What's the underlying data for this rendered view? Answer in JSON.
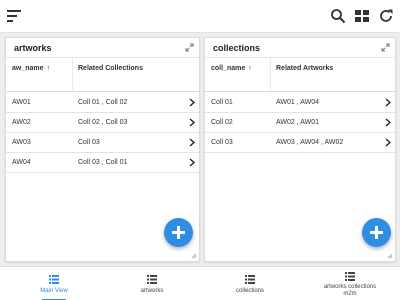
{
  "toolbar": {
    "menu_icon": "sort-menu-icon",
    "search_icon": "search-icon",
    "grid_icon": "grid-view-icon",
    "refresh_icon": "refresh-icon"
  },
  "artworks_panel": {
    "title": "artworks",
    "columns": [
      "aw_name",
      "Related Collections"
    ],
    "sort_indicator": "↑",
    "rows": [
      {
        "name": "AW01",
        "related": "Coll 01 , Coll 02"
      },
      {
        "name": "AW02",
        "related": "Coll 02 , Coll 03"
      },
      {
        "name": "AW03",
        "related": "Coll 03"
      },
      {
        "name": "AW04",
        "related": "Coll 03 , Coll 01"
      }
    ]
  },
  "collections_panel": {
    "title": "collections",
    "columns": [
      "coll_name",
      "Related Artworks"
    ],
    "sort_indicator": "↑",
    "rows": [
      {
        "name": "Coll 01",
        "related": "AW01 , AW04"
      },
      {
        "name": "Coll 02",
        "related": "AW02 , AW01"
      },
      {
        "name": "Coll 03",
        "related": "AW03 , AW04 , AW02"
      }
    ]
  },
  "bottom_nav": {
    "tabs": [
      {
        "label": "Main View",
        "active": true
      },
      {
        "label": "artworks",
        "active": false
      },
      {
        "label": "collections",
        "active": false
      },
      {
        "label": "artworks collections m2m",
        "active": false
      }
    ]
  },
  "colors": {
    "accent": "#2f8de4",
    "background": "#ededed"
  }
}
